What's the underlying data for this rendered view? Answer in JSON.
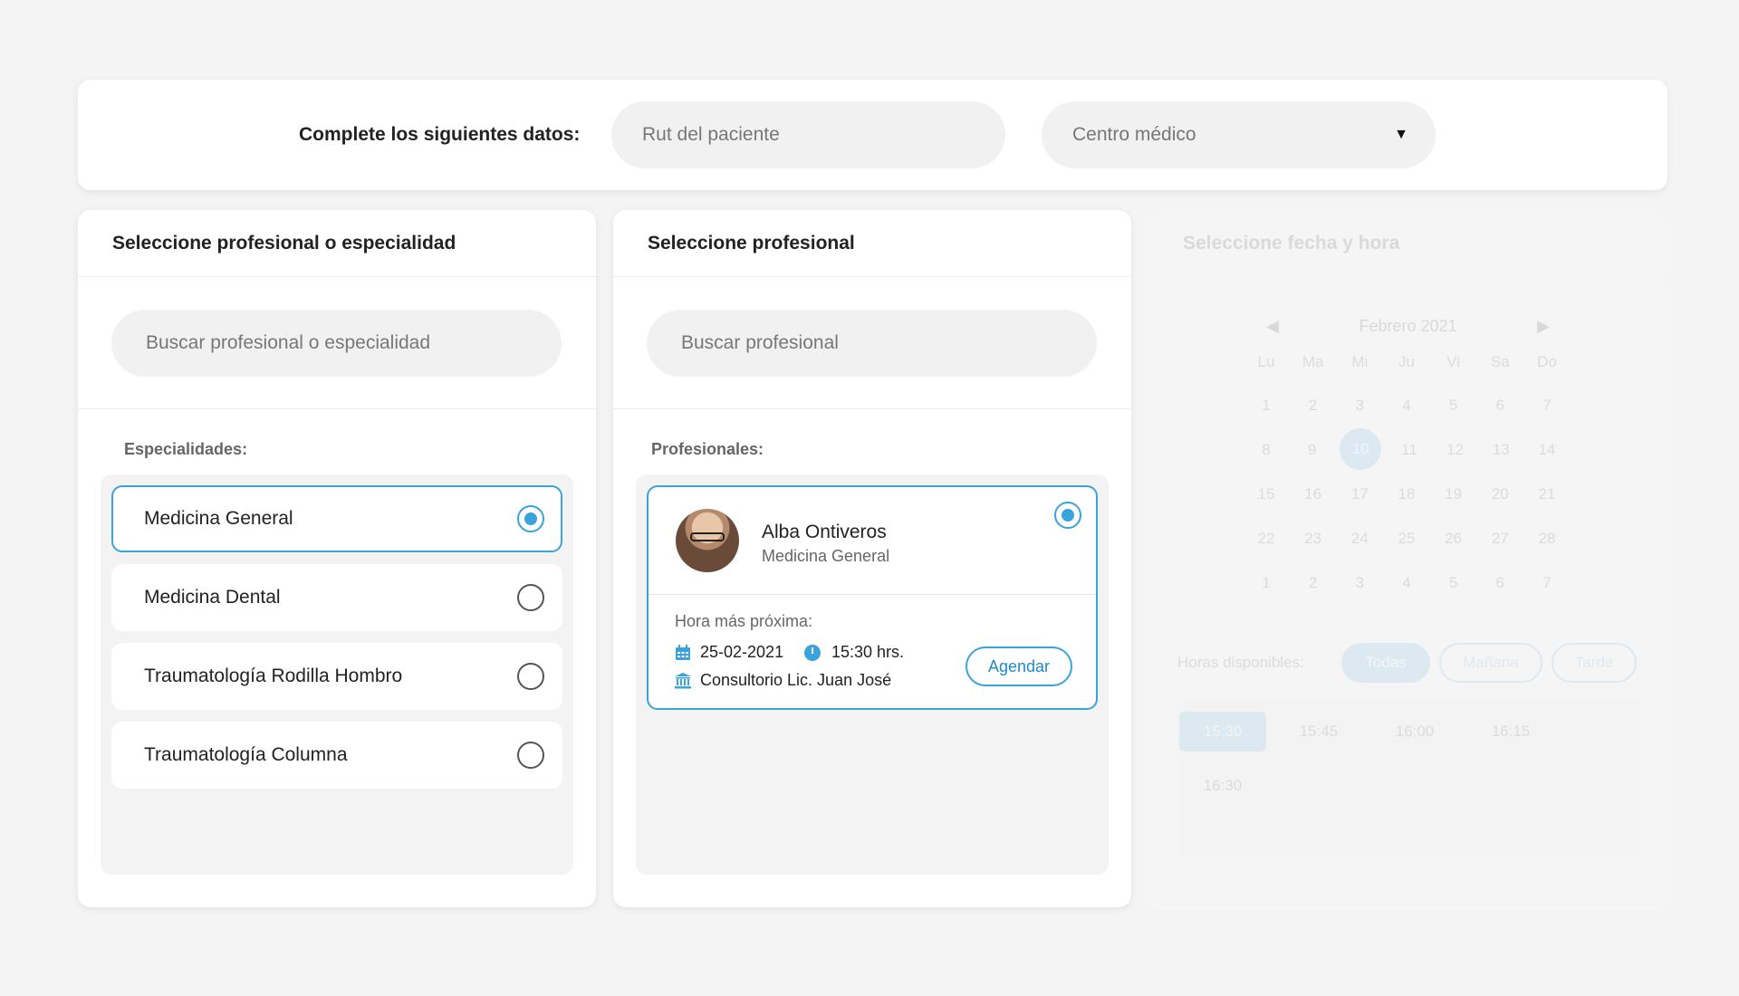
{
  "header": {
    "label": "Complete los siguientes datos:",
    "rut_placeholder": "Rut del paciente",
    "centro_placeholder": "Centro médico",
    "centro_caret": "▼"
  },
  "specialty_panel": {
    "title": "Seleccione profesional o especialidad",
    "search_placeholder": "Buscar profesional o especialidad",
    "list_label": "Especialidades:",
    "items": [
      {
        "label": "Medicina General",
        "selected": true
      },
      {
        "label": "Medicina Dental",
        "selected": false
      },
      {
        "label": "Traumatología Rodilla Hombro",
        "selected": false
      },
      {
        "label": "Traumatología Columna",
        "selected": false
      }
    ]
  },
  "professional_panel": {
    "title": "Seleccione profesional",
    "search_placeholder": "Buscar profesional",
    "list_label": "Profesionales:",
    "professional": {
      "name": "Alba Ontiveros",
      "specialty": "Medicina General",
      "next_label": "Hora más próxima:",
      "date": "25-02-2021",
      "time": "15:30 hrs.",
      "place": "Consultorio Lic. Juan José",
      "action_label": "Agendar",
      "selected": true
    }
  },
  "calendar_panel": {
    "title": "Seleccione fecha y hora",
    "month": "Febrero 2021",
    "prev_icon": "◀",
    "next_icon": "▶",
    "weekdays": [
      "Lu",
      "Ma",
      "Mi",
      "Ju",
      "Vi",
      "Sa",
      "Do"
    ],
    "weeks": [
      [
        "1",
        "2",
        "3",
        "4",
        "5",
        "6",
        "7"
      ],
      [
        "8",
        "9",
        "10",
        "11",
        "12",
        "13",
        "14"
      ],
      [
        "15",
        "16",
        "17",
        "18",
        "19",
        "20",
        "21"
      ],
      [
        "22",
        "23",
        "24",
        "25",
        "26",
        "27",
        "28"
      ],
      [
        "1",
        "2",
        "3",
        "4",
        "5",
        "6",
        "7"
      ]
    ],
    "selected_day": "10",
    "hours_label": "Horas disponibles:",
    "filters": [
      "Todas",
      "Mañana",
      "Tarde"
    ],
    "selected_filter": "Todas",
    "slots": [
      "15:30",
      "15:45",
      "16:00",
      "16:15",
      "16:30"
    ],
    "selected_slot": "15:30"
  },
  "colors": {
    "accent": "#3aa3dc",
    "background": "#f4f4f4"
  }
}
